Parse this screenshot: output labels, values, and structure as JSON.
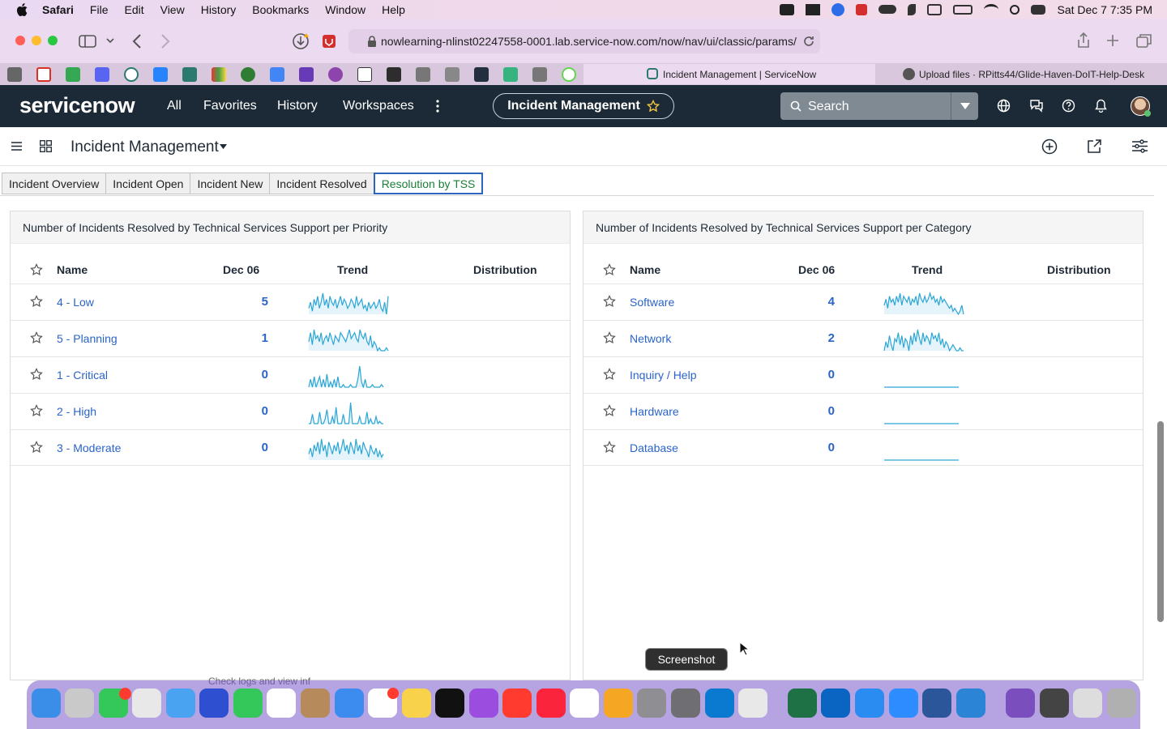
{
  "menubar": {
    "app": "Safari",
    "items": [
      "File",
      "Edit",
      "View",
      "History",
      "Bookmarks",
      "Window",
      "Help"
    ],
    "datetime": "Sat Dec 7  7:35 PM"
  },
  "browser": {
    "url": "nowlearning-nlinst02247558-0001.lab.service-now.com/now/nav/ui/classic/params/",
    "tabs": [
      {
        "label": "Incident Management | ServiceNow",
        "active": true
      },
      {
        "label": "Upload files · RPitts44/Glide-Haven-DoIT-Help-Desk",
        "active": false
      }
    ]
  },
  "sn": {
    "logo": "servicenow",
    "nav": [
      "All",
      "Favorites",
      "History",
      "Workspaces"
    ],
    "context_pill": "Incident Management",
    "search_placeholder": "Search",
    "page_title": "Incident Management"
  },
  "dashboard_tabs": [
    {
      "label": "Incident Overview",
      "active": false
    },
    {
      "label": "Incident Open",
      "active": false
    },
    {
      "label": "Incident New",
      "active": false
    },
    {
      "label": "Incident Resolved",
      "active": false
    },
    {
      "label": "Resolution by TSS",
      "active": true
    }
  ],
  "panels": [
    {
      "title": "Number of Incidents Resolved by Technical Services Support per Priority",
      "columns": {
        "name": "Name",
        "date": "Dec 06",
        "trend": "Trend",
        "distribution": "Distribution"
      },
      "rows": [
        {
          "name": "4 - Low",
          "value": "5",
          "trend": [
            2,
            4,
            1,
            5,
            3,
            6,
            2,
            4,
            7,
            3,
            5,
            2,
            6,
            4,
            3,
            5,
            2,
            4,
            6,
            3,
            5,
            4,
            2,
            3,
            5,
            4,
            2,
            6,
            3,
            4,
            5,
            2,
            3,
            1,
            4,
            2,
            3,
            4,
            2,
            3,
            5,
            2,
            1,
            4,
            0,
            6
          ]
        },
        {
          "name": "5 - Planning",
          "value": "1",
          "trend": [
            3,
            6,
            2,
            7,
            4,
            5,
            3,
            6,
            2,
            4,
            5,
            3,
            6,
            4,
            2,
            5,
            4,
            3,
            6,
            5,
            4,
            3,
            5,
            7,
            4,
            5,
            6,
            4,
            3,
            7,
            5,
            4,
            6,
            3,
            2,
            5,
            1,
            3,
            2,
            0,
            1,
            0,
            0,
            0,
            1,
            0
          ]
        },
        {
          "name": "1 - Critical",
          "value": "0",
          "trend": [
            0,
            3,
            0,
            4,
            0,
            2,
            4,
            0,
            3,
            0,
            5,
            0,
            2,
            0,
            3,
            0,
            4,
            0,
            0,
            1,
            0,
            0,
            0,
            1,
            0,
            0,
            0,
            3,
            8,
            2,
            0,
            3,
            0,
            0,
            0,
            1,
            0,
            0,
            0,
            0,
            1,
            0
          ]
        },
        {
          "name": "2 - High",
          "value": "0",
          "trend": [
            0,
            0,
            4,
            0,
            0,
            0,
            5,
            0,
            0,
            2,
            6,
            0,
            0,
            3,
            0,
            7,
            0,
            0,
            0,
            4,
            0,
            0,
            0,
            9,
            0,
            0,
            0,
            0,
            3,
            0,
            0,
            0,
            5,
            0,
            2,
            0,
            0,
            3,
            0,
            1,
            0,
            0
          ]
        },
        {
          "name": "3 - Moderate",
          "value": "0",
          "trend": [
            2,
            4,
            1,
            5,
            3,
            6,
            2,
            7,
            3,
            5,
            1,
            6,
            4,
            2,
            5,
            3,
            6,
            2,
            4,
            7,
            3,
            5,
            2,
            6,
            4,
            2,
            7,
            3,
            5,
            2,
            6,
            4,
            3,
            1,
            5,
            3,
            2,
            4,
            1,
            3,
            1,
            2
          ]
        }
      ]
    },
    {
      "title": "Number of Incidents Resolved by Technical Services Support per Category",
      "columns": {
        "name": "Name",
        "date": "Dec 06",
        "trend": "Trend",
        "distribution": "Distribution"
      },
      "rows": [
        {
          "name": "Software",
          "value": "4",
          "trend": [
            3,
            5,
            2,
            6,
            4,
            5,
            3,
            6,
            4,
            7,
            3,
            6,
            5,
            4,
            6,
            3,
            5,
            4,
            6,
            3,
            7,
            5,
            4,
            6,
            4,
            5,
            7,
            5,
            6,
            4,
            5,
            3,
            6,
            4,
            5,
            4,
            3,
            2,
            3,
            1,
            2,
            1,
            0,
            1,
            3,
            0
          ]
        },
        {
          "name": "Network",
          "value": "2",
          "trend": [
            0,
            3,
            1,
            5,
            2,
            0,
            4,
            3,
            6,
            2,
            5,
            1,
            4,
            3,
            0,
            5,
            2,
            6,
            3,
            7,
            4,
            2,
            6,
            3,
            5,
            4,
            2,
            6,
            4,
            5,
            3,
            6,
            2,
            4,
            1,
            3,
            2,
            0,
            1,
            2,
            1,
            0,
            0,
            1,
            0,
            0
          ]
        },
        {
          "name": "Inquiry / Help",
          "value": "0",
          "trend": [
            0,
            0,
            0,
            0,
            0,
            0,
            0,
            0,
            0,
            0,
            0,
            0
          ]
        },
        {
          "name": "Hardware",
          "value": "0",
          "trend": [
            0,
            0,
            0,
            0,
            0,
            0,
            0,
            0,
            0,
            0,
            0,
            0
          ]
        },
        {
          "name": "Database",
          "value": "0",
          "trend": [
            0,
            0,
            0,
            0,
            0,
            0,
            0,
            0,
            0,
            0,
            0,
            0
          ]
        }
      ]
    }
  ],
  "footnote": "Check logs and view inf",
  "tooltip": "Screenshot",
  "colors": {
    "link": "#2a64c9",
    "header_bg": "#1b2a36",
    "spark": "#2ba6d6",
    "active_tab": "#1a7f37"
  }
}
